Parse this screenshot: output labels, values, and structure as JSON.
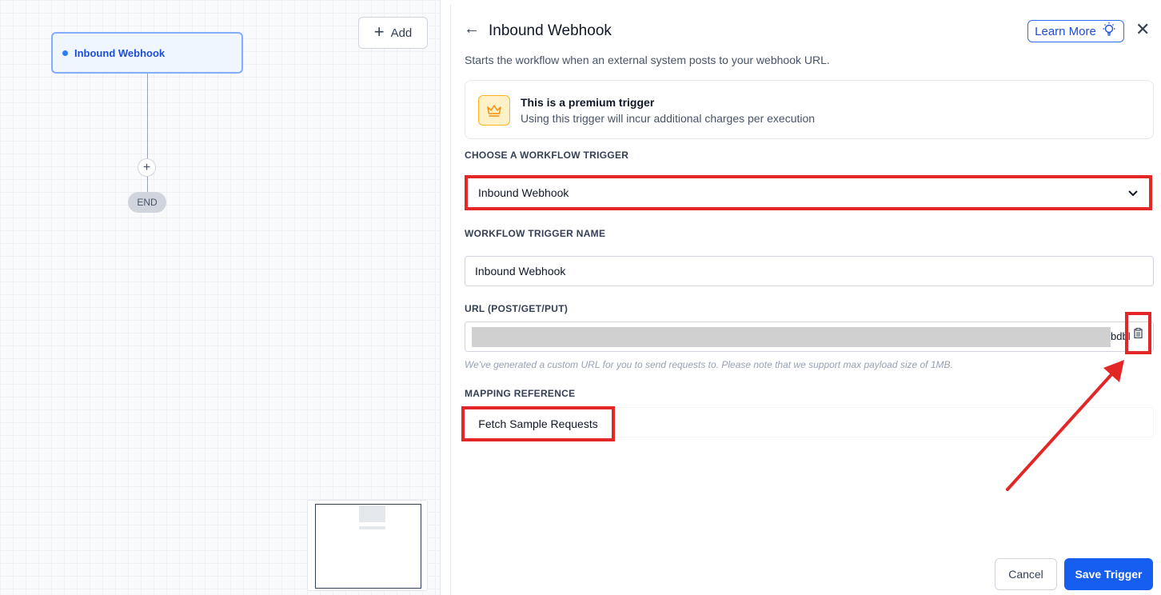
{
  "canvas": {
    "add_button_label": "Add",
    "trigger_node_label": "Inbound Webhook",
    "end_label": "END"
  },
  "panel": {
    "title": "Inbound Webhook",
    "learn_more_label": "Learn More",
    "description": "Starts the workflow when an external system posts to your webhook URL.",
    "premium": {
      "title": "This is a premium trigger",
      "subtitle": "Using this trigger will incur additional charges per execution"
    },
    "choose_trigger": {
      "label": "CHOOSE A WORKFLOW TRIGGER",
      "selected": "Inbound Webhook"
    },
    "trigger_name": {
      "label": "WORKFLOW TRIGGER NAME",
      "value": "Inbound Webhook"
    },
    "url": {
      "label": "URL (POST/GET/PUT)",
      "visible_tail": "bdbl",
      "helper": "We've generated a custom URL for you to send requests to. Please note that we support max payload size of 1MB."
    },
    "mapping": {
      "label": "MAPPING REFERENCE",
      "fetch_button_label": "Fetch Sample Requests"
    },
    "footer": {
      "cancel_label": "Cancel",
      "save_label": "Save Trigger"
    }
  },
  "colors": {
    "primary": "#155eef",
    "highlight": "#e32626",
    "premium_bg": "#fef0c7",
    "premium_icon": "#f79009"
  }
}
